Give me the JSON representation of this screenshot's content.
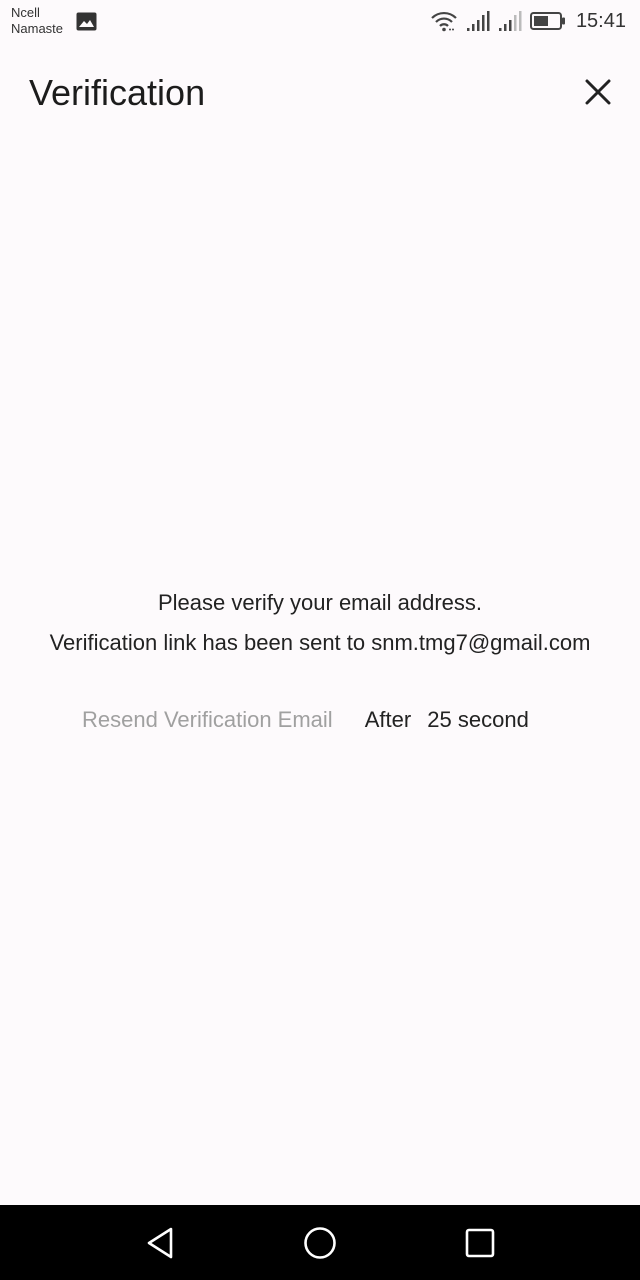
{
  "status_bar": {
    "carrier_line1": "Ncell",
    "carrier_line2": "Namaste",
    "notification_icon": "gallery-icon",
    "icons": [
      "wifi-icon",
      "signal-icon",
      "signal-icon",
      "battery-icon"
    ],
    "time": "15:41"
  },
  "header": {
    "title": "Verification",
    "close_icon": "close-icon"
  },
  "message": {
    "line1": "Please verify your email address.",
    "line2": "Verification link has been sent to snm.tmg7@gmail.com"
  },
  "resend": {
    "label": "Resend Verification Email",
    "after_label": "After",
    "seconds": "25",
    "unit": "second"
  },
  "nav_bar": {
    "icons": [
      "back-icon",
      "home-icon",
      "recents-icon"
    ]
  },
  "colors": {
    "background": "#fdfafc",
    "resend_disabled": "#a0a0a0",
    "nav_bar": "#000000"
  }
}
